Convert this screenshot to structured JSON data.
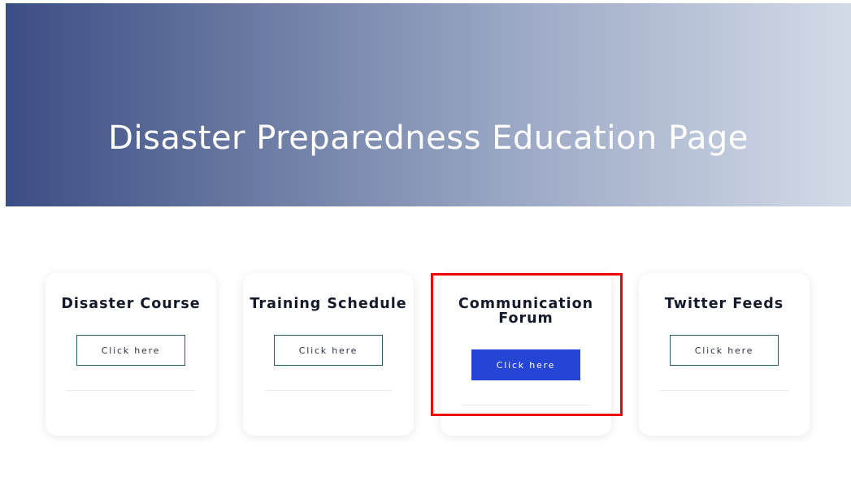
{
  "hero": {
    "title": "Disaster Preparedness Education Page"
  },
  "cards": [
    {
      "title": "Disaster Course",
      "button_label": "Click here"
    },
    {
      "title": "Training Schedule",
      "button_label": "Click here"
    },
    {
      "title": "Communication Forum",
      "button_label": "Click here"
    },
    {
      "title": "Twitter Feeds",
      "button_label": "Click here"
    }
  ],
  "colors": {
    "hero_gradient_start": "#3b4d85",
    "hero_gradient_end": "#d3dbe8",
    "active_button": "#2545d6",
    "highlight_border": "#ee0000"
  }
}
